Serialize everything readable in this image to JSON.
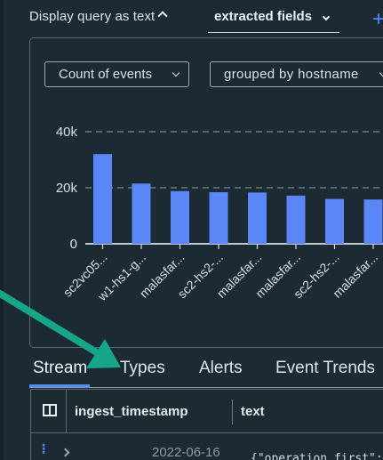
{
  "topbar": {
    "display_query_label": "Display query as text",
    "extracted_fields_label": "extracted fields"
  },
  "controls": {
    "metric_label": "Count of events",
    "group_label": "grouped by hostname"
  },
  "chart_data": {
    "type": "bar",
    "categories": [
      "sc2vc05...",
      "w1-hs1-g...",
      "malasfar...",
      "sc2-hs2-...",
      "malasfar...",
      "malasfar...",
      "sc2-hs2-...",
      "malasfar..."
    ],
    "values": [
      32000,
      21500,
      18800,
      18400,
      18300,
      17200,
      16000,
      15800
    ],
    "y_ticks": [
      "40k",
      "20k",
      "0"
    ],
    "ylim": [
      0,
      40000
    ],
    "grid": "horizontal dashed",
    "colors": {
      "bar": "#5b86f5",
      "grid": "#7e8a92",
      "axis": "#d8e0e5"
    }
  },
  "tabs": [
    {
      "label": "Stream",
      "active": true
    },
    {
      "label": "Types",
      "active": false
    },
    {
      "label": "Alerts",
      "active": false
    },
    {
      "label": "Event Trends",
      "active": false
    }
  ],
  "table": {
    "columns": [
      "ingest_timestamp",
      "text"
    ],
    "rows": [
      {
        "ingest_timestamp": "2022-06-16",
        "text": "{\"operation_first\":"
      }
    ]
  },
  "icons": {
    "column_layout": "column-layout-icon",
    "row_menu": "row-menu-icon",
    "expand": "chevron-right-icon",
    "annotation_arrow": "annotation-arrow-icon"
  },
  "colors": {
    "background": "#1b2a33",
    "accent": "#4c8dff",
    "annotation": "#18a68a"
  }
}
